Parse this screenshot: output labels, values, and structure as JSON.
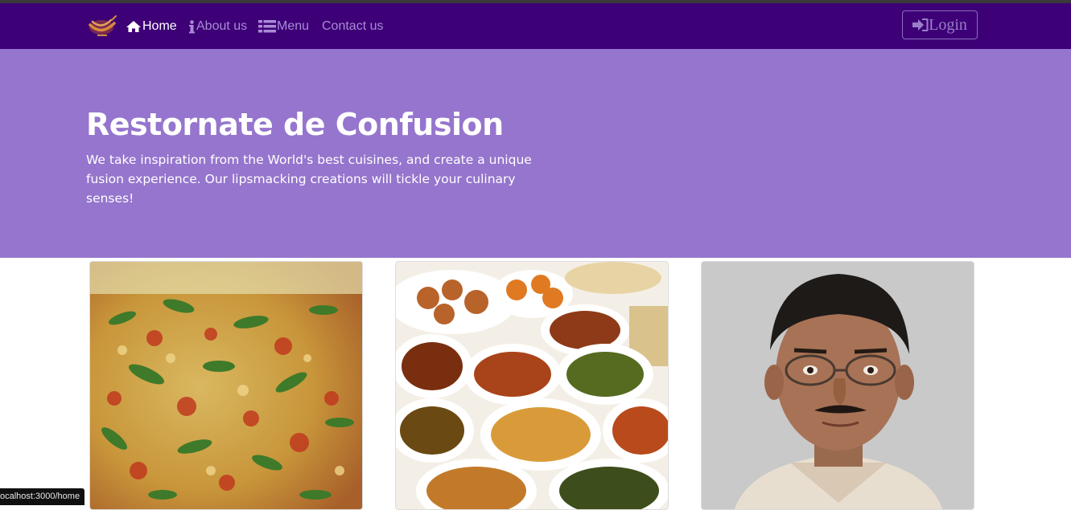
{
  "theme": {
    "nav_bg": "#3d0077",
    "jumbo_bg": "#9575cd"
  },
  "nav": {
    "logo": "brand-logo",
    "items": [
      {
        "label": "Home",
        "icon": "home-icon",
        "active": true
      },
      {
        "label": "About us",
        "icon": "info-icon",
        "active": false
      },
      {
        "label": "Menu",
        "icon": "list-icon",
        "active": false
      },
      {
        "label": "Contact us",
        "icon": "",
        "active": false
      }
    ],
    "login": {
      "label": "Login",
      "icon": "sign-in-icon"
    }
  },
  "jumbotron": {
    "title": "Restornate de Confusion",
    "text": "We take inspiration from the World's best cuisines, and create a unique fusion experience. Our lipsmacking creations will tickle your culinary senses!"
  },
  "cards": [
    {
      "image": "pizza-image"
    },
    {
      "image": "buffet-image"
    },
    {
      "image": "chef-portrait-image"
    }
  ],
  "status_bar": {
    "url": "ocalhost:3000/home"
  }
}
